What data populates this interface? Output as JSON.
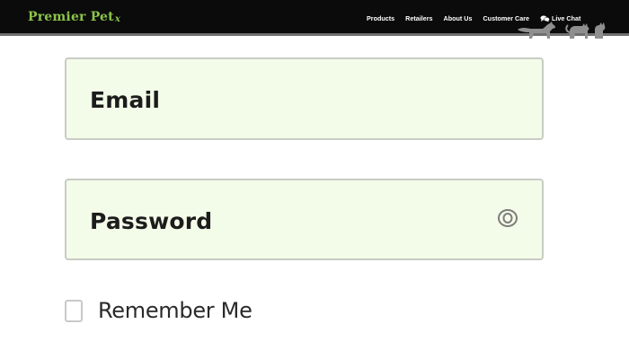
{
  "header": {
    "brand": "Premier Pet",
    "brand_swirl": "x",
    "nav": {
      "products": "Products",
      "retailers": "Retailers",
      "about": "About Us",
      "customer_care": "Customer Care",
      "live_chat": "Live Chat"
    },
    "icons": {
      "chat": "chat-bubbles-icon",
      "pets": "dog-and-cat-silhouette"
    }
  },
  "form": {
    "email_label": "Email",
    "password_label": "Password",
    "remember_label": "Remember Me",
    "remember_checked": false,
    "password_toggle_icon": "eye-icon"
  },
  "colors": {
    "header_bg": "#0b0b0b",
    "brand": "#8bc34a",
    "field_bg": "#f3fce8",
    "field_border": "#c8ccc4",
    "text": "#1c1c1c"
  }
}
